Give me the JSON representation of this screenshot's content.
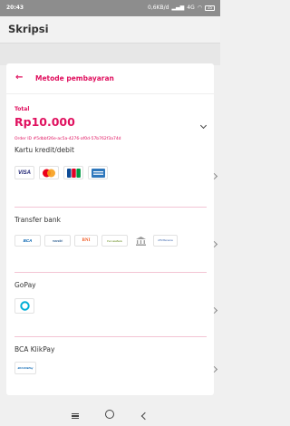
{
  "status": {
    "time": "20:43",
    "network": "0,6KB/d",
    "signal": "4G",
    "battery": "35"
  },
  "app": {
    "title": "Skripsi"
  },
  "payment": {
    "back_glyph": "←",
    "header": "Metode pembayaran",
    "total_label": "Total",
    "amount": "Rp10.000",
    "order_id": "Order ID #5dbbf26e-ac5a-4276-af0d-57b762f3a74d"
  },
  "methods": [
    {
      "name": "Kartu kredit/debit",
      "logos": [
        "VISA",
        "Mastercard",
        "JCB",
        "AMEX"
      ]
    },
    {
      "name": "Transfer bank",
      "logos": [
        "BCA",
        "Mandiri",
        "BNI",
        "Permata",
        "Bank lainnya",
        "Bank lain"
      ]
    },
    {
      "name": "GoPay",
      "logos": [
        "GoPay"
      ]
    },
    {
      "name": "BCA KlikPay",
      "logos": [
        "BCA KlikPay"
      ]
    }
  ],
  "logo_text": {
    "visa": "VISA",
    "bca": "BCA",
    "mandiri": "mandiri",
    "bni": "BNI",
    "permata": "PermataBank",
    "bank_lain": "ATM Bersama",
    "klikpay": "BCA KlikPay"
  },
  "colors": {
    "accent": "#e0115f",
    "visa": "#1a1f71",
    "mc_red": "#eb001b",
    "mc_orange": "#f79e1b",
    "amex": "#2e77bc",
    "bca": "#0060af",
    "bni": "#f15a23",
    "gopay": "#00aed6"
  }
}
